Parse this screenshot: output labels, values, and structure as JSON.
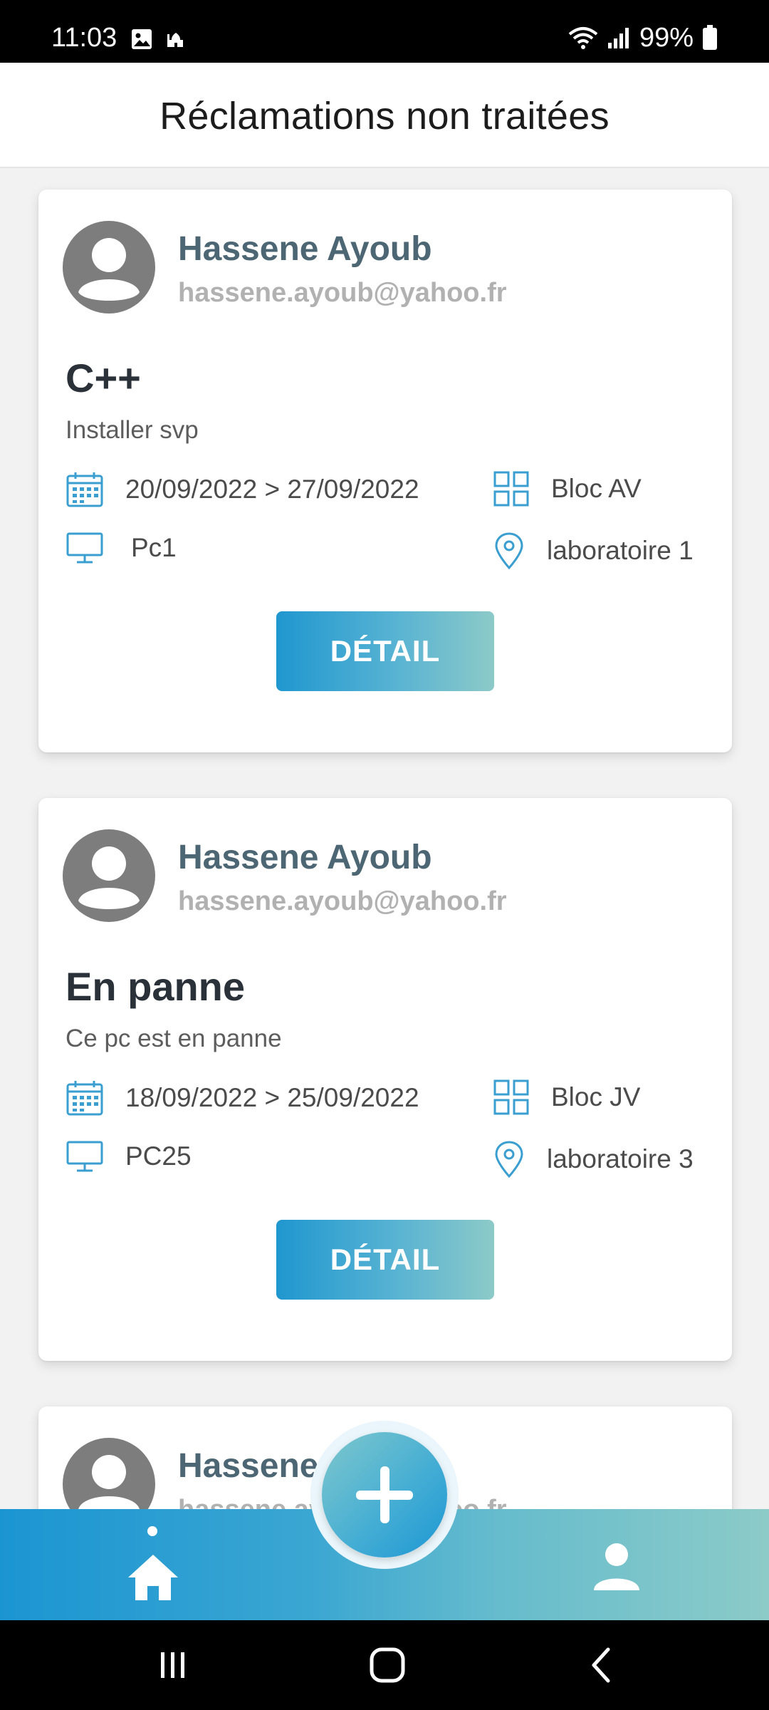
{
  "status_bar": {
    "time": "11:03",
    "battery": "99%",
    "icons": [
      "gallery-icon",
      "mosque-icon",
      "wifi-icon",
      "signal-icon",
      "battery-icon"
    ]
  },
  "header": {
    "title": "Réclamations non traitées"
  },
  "claims": [
    {
      "user_name": "Hassene Ayoub",
      "user_email": "hassene.ayoub@yahoo.fr",
      "title": "C++",
      "description": "Installer svp",
      "dates": "20/09/2022 > 27/09/2022",
      "bloc": "Bloc AV",
      "pc": "Pc1",
      "lab": "laboratoire 1",
      "button": "DÉTAIL"
    },
    {
      "user_name": "Hassene Ayoub",
      "user_email": "hassene.ayoub@yahoo.fr",
      "title": "En panne",
      "description": "Ce pc est en panne",
      "dates": "18/09/2022 > 25/09/2022",
      "bloc": "Bloc JV",
      "pc": "PC25",
      "lab": "laboratoire 3",
      "button": "DÉTAIL"
    },
    {
      "user_name": "Hassene Ayoub",
      "user_email": "hassene.ayoub@yahoo.fr"
    }
  ],
  "bottom_nav": {
    "items": [
      "home-icon",
      "add-icon",
      "profile-icon"
    ],
    "active": "home"
  },
  "colors": {
    "accent_blue": "#1f97cf",
    "accent_teal": "#8ccac8",
    "icon_blue": "#3a9fd0",
    "name_color": "#4c6673"
  }
}
